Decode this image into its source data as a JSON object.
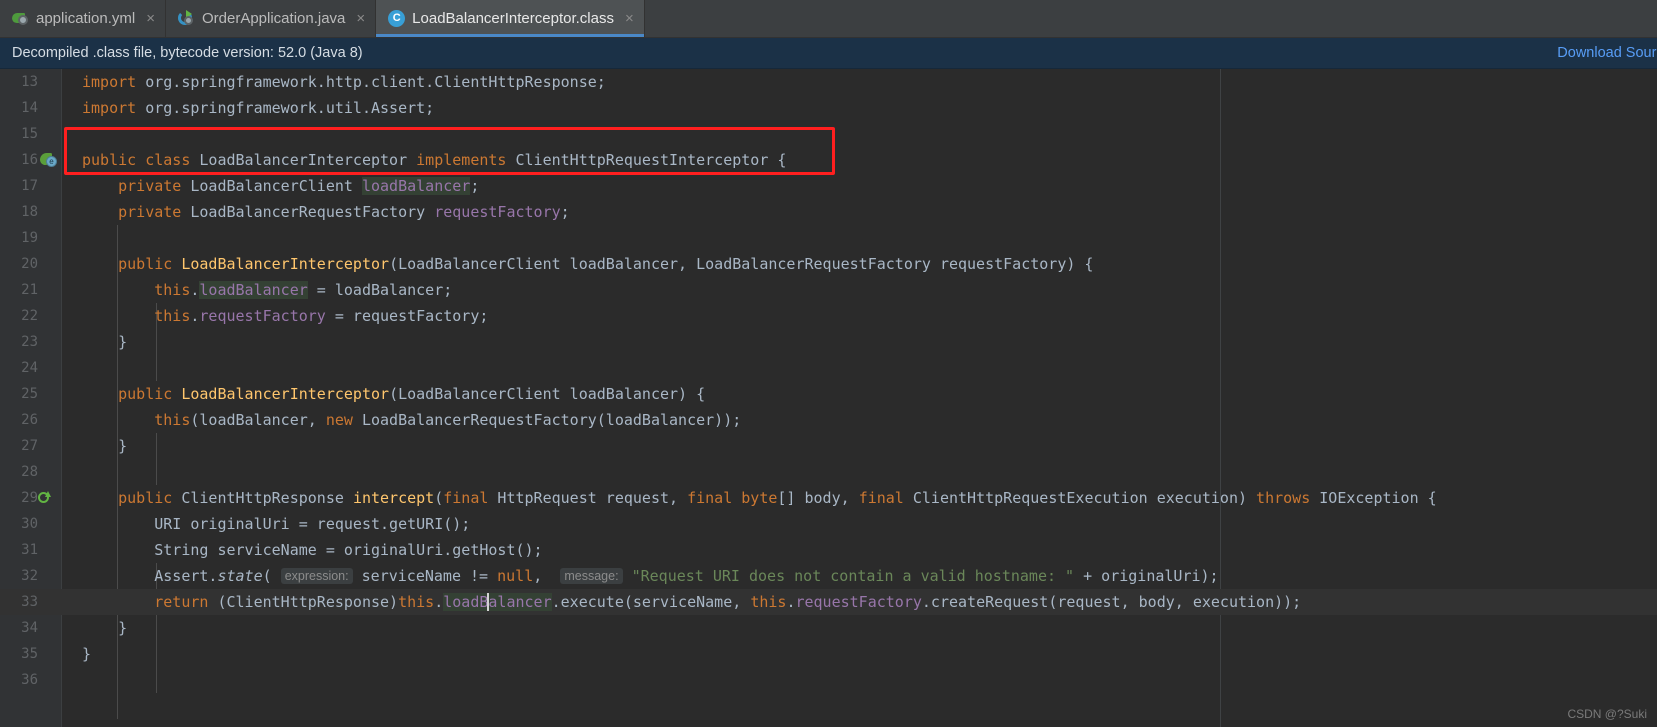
{
  "tabs": [
    {
      "label": "application.yml",
      "icon": "spring-leaf-icon",
      "close": "×",
      "active": false
    },
    {
      "label": "OrderApplication.java",
      "icon": "spring-boot-icon",
      "close": "×",
      "active": false
    },
    {
      "label": "LoadBalancerInterceptor.class",
      "icon": "class-file-icon",
      "badge": "C",
      "close": "×",
      "active": true
    }
  ],
  "banner": {
    "message": "Decompiled .class file, bytecode version: 52.0 (Java 8)",
    "link": "Download Sources"
  },
  "editor": {
    "watermark": "CSDN @?Suki",
    "cursor_line": 33,
    "lines": [
      {
        "n": "13",
        "indent": 0
      },
      {
        "n": "14",
        "indent": 0
      },
      {
        "n": "15",
        "indent": 0
      },
      {
        "n": "16",
        "indent": 0,
        "gutter": "spring-bean-icon"
      },
      {
        "n": "17",
        "indent": 1
      },
      {
        "n": "18",
        "indent": 1
      },
      {
        "n": "19",
        "indent": 1
      },
      {
        "n": "20",
        "indent": 1
      },
      {
        "n": "21",
        "indent": 2
      },
      {
        "n": "22",
        "indent": 2
      },
      {
        "n": "23",
        "indent": 1
      },
      {
        "n": "24",
        "indent": 1
      },
      {
        "n": "25",
        "indent": 1
      },
      {
        "n": "26",
        "indent": 2
      },
      {
        "n": "27",
        "indent": 1
      },
      {
        "n": "28",
        "indent": 1
      },
      {
        "n": "29",
        "indent": 1,
        "gutter": "implements-method-icon"
      },
      {
        "n": "30",
        "indent": 2
      },
      {
        "n": "31",
        "indent": 2
      },
      {
        "n": "32",
        "indent": 2
      },
      {
        "n": "33",
        "indent": 2,
        "current": true
      },
      {
        "n": "34",
        "indent": 1
      },
      {
        "n": "35",
        "indent": 0
      },
      {
        "n": "36",
        "indent": 0
      }
    ],
    "source_text": [
      "import org.springframework.http.client.ClientHttpResponse;",
      "import org.springframework.util.Assert;",
      "",
      "public class LoadBalancerInterceptor implements ClientHttpRequestInterceptor {",
      "    private LoadBalancerClient loadBalancer;",
      "    private LoadBalancerRequestFactory requestFactory;",
      "",
      "    public LoadBalancerInterceptor(LoadBalancerClient loadBalancer, LoadBalancerRequestFactory requestFactory) {",
      "        this.loadBalancer = loadBalancer;",
      "        this.requestFactory = requestFactory;",
      "    }",
      "",
      "    public LoadBalancerInterceptor(LoadBalancerClient loadBalancer) {",
      "        this(loadBalancer, new LoadBalancerRequestFactory(loadBalancer));",
      "    }",
      "",
      "    public ClientHttpResponse intercept(final HttpRequest request, final byte[] body, final ClientHttpRequestExecution execution) throws IOException {",
      "        URI originalUri = request.getURI();",
      "        String serviceName = originalUri.getHost();",
      "        Assert.state(serviceName != null, \"Request URI does not contain a valid hostname: \" + originalUri);",
      "        return (ClientHttpResponse)this.loadBalancer.execute(serviceName, this.requestFactory.createRequest(request, body, execution));",
      "    }",
      "}",
      ""
    ],
    "inline_hints": [
      {
        "line": "32",
        "label": "expression:"
      },
      {
        "line": "32",
        "label": "message:"
      }
    ],
    "annotation": {
      "shape": "rectangle",
      "color": "#ff1f1f",
      "targets_line": "16"
    }
  },
  "colors": {
    "editor_bg": "#2b2b2b",
    "gutter_bg": "#313335",
    "tabbar_bg": "#3c3f41",
    "active_tab_bg": "#4e5254",
    "tab_underline": "#4a88c7",
    "banner_bg": "#1b3147",
    "link": "#589df6",
    "keyword": "#cc7832",
    "string": "#6a8759",
    "field": "#9876aa",
    "method": "#ffc66d",
    "number": "#6897bb",
    "default_text": "#a9b7c6",
    "annotation": "#ff1f1f",
    "occurrence_highlight": "#344134"
  }
}
